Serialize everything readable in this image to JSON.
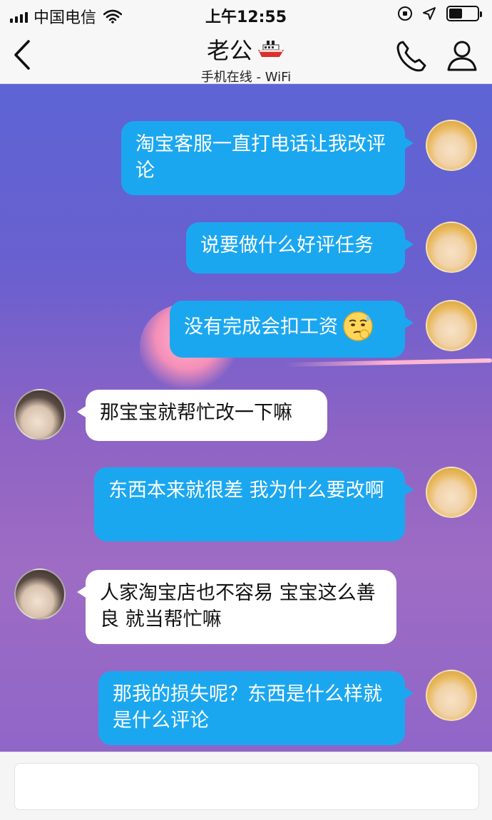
{
  "status_bar": {
    "carrier": "中国电信",
    "time": "上午12:55",
    "icons": [
      "signal-icon",
      "wifi-icon",
      "orientation-lock-icon",
      "location-icon",
      "battery-icon"
    ]
  },
  "header": {
    "title": "老公",
    "subtitle": "手机在线 - WiFi",
    "title_icon": "ship-icon",
    "back_icon": "chevron-left-icon",
    "phone_icon": "phone-icon",
    "profile_icon": "person-icon"
  },
  "messages": [
    {
      "sender": "me",
      "avatar": "blond-anime-avatar",
      "text": "淘宝客服一直打电话让我改评论"
    },
    {
      "sender": "me",
      "avatar": "blond-anime-avatar",
      "text": "说要做什么好评任务"
    },
    {
      "sender": "me",
      "avatar": "blond-anime-avatar",
      "text": "没有完成会扣工资",
      "emoji": "sweating-face-emoji"
    },
    {
      "sender": "other",
      "avatar": "dark-hair-anime-avatar",
      "text": "那宝宝就帮忙改一下嘛"
    },
    {
      "sender": "me",
      "avatar": "blond-anime-avatar",
      "text": "东西本来就很差 我为什么要改啊"
    },
    {
      "sender": "other",
      "avatar": "dark-hair-anime-avatar",
      "text": "人家淘宝店也不容易 宝宝这么善良 就当帮忙嘛"
    },
    {
      "sender": "me",
      "avatar": "blond-anime-avatar",
      "text": "那我的损失呢？东西是什么样就是什么评论"
    }
  ],
  "input": {
    "value": "",
    "placeholder": ""
  },
  "colors": {
    "my_bubble": "#1ba7f0",
    "their_bubble": "#ffffff",
    "chat_bg_top": "#5d64d4",
    "chat_bg_bottom": "#9e6cc4"
  }
}
